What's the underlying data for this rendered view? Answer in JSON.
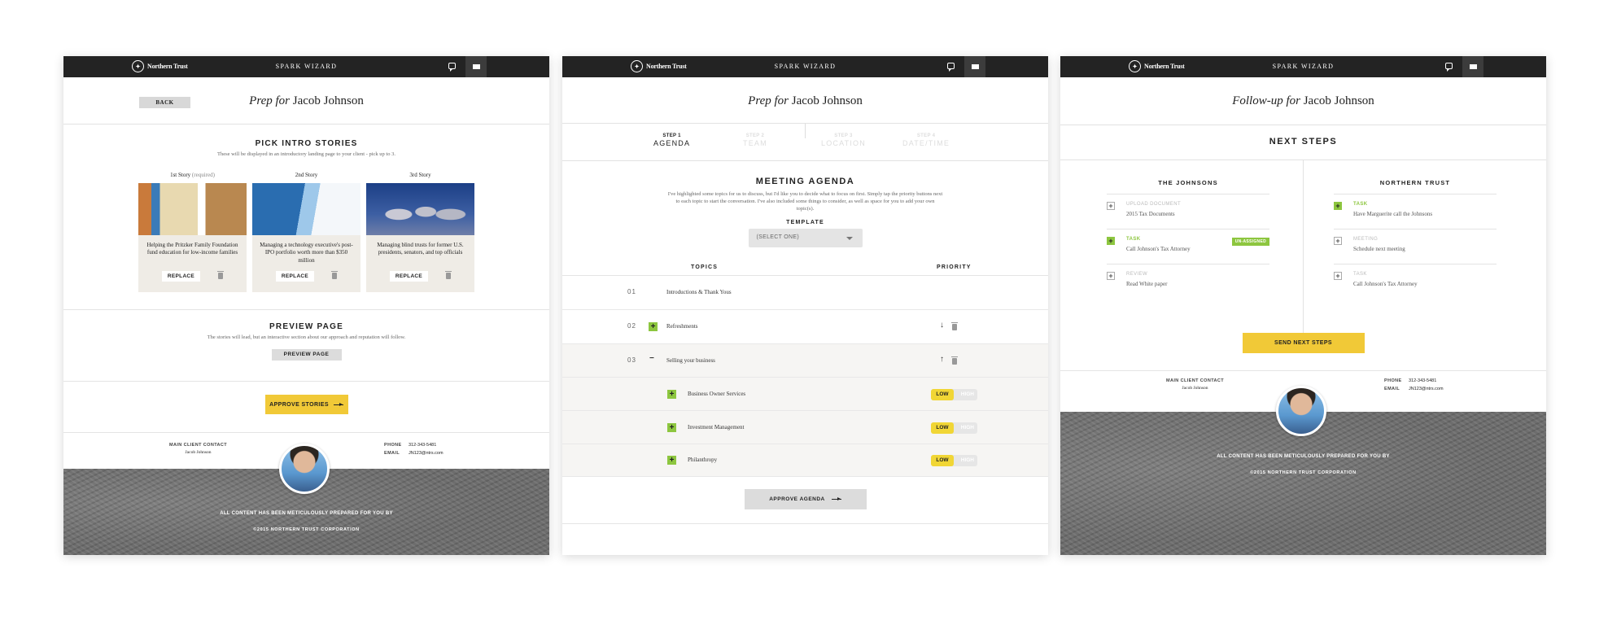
{
  "common": {
    "brand": "Northern Trust",
    "app_title": "Spark Wizard",
    "client_first": "Jacob Johnson",
    "contact": {
      "main_label": "MAIN CLIENT CONTACT",
      "main_name": "Jacob Johnson",
      "phone_label": "PHONE",
      "phone": "312-343-5481",
      "email_label": "EMAIL",
      "email": "JN123@ntrs.com"
    },
    "footer_line1": "ALL CONTENT HAS BEEN METICULOUSLY PREPARED FOR YOU BY",
    "footer_line2": "©2015 NORTHERN TRUST CORPORATION"
  },
  "panel1": {
    "back_label": "BACK",
    "title_italic": "Prep for",
    "title_name": "Jacob Johnson",
    "pick_heading": "PICK INTRO STORIES",
    "pick_sub": "These will be displayed in an introductory landing page to your client - pick up to 3.",
    "stories": [
      {
        "label": "1st Story",
        "note": "(required)",
        "text": "Helping the Pritzker Family Foundation fund education for low-income families",
        "replace": "REPLACE"
      },
      {
        "label": "2nd Story",
        "note": "",
        "text": "Managing a technology executive's post-IPO portfolio worth more than $350 million",
        "replace": "REPLACE"
      },
      {
        "label": "3rd Story",
        "note": "",
        "text": "Managing blind trusts for former U.S. presidents, senators, and top officials",
        "replace": "REPLACE"
      }
    ],
    "preview_heading": "PREVIEW PAGE",
    "preview_sub": "The stories will lead, but an interactive section about our approach and reputation will follow.",
    "preview_button": "PREVIEW PAGE",
    "approve_button": "APPROVE STORIES"
  },
  "panel2": {
    "title_italic": "Prep for",
    "title_name": "Jacob Johnson",
    "steps": [
      {
        "num": "STEP 1",
        "name": "AGENDA"
      },
      {
        "num": "STEP 2",
        "name": "TEAM"
      },
      {
        "num": "STEP 3",
        "name": "LOCATION"
      },
      {
        "num": "STEP 4",
        "name": "DATE/TIME"
      }
    ],
    "agenda_heading": "MEETING AGENDA",
    "agenda_sub": "I've highlighted some topics for us to discuss, but I'd like you to decide what to focus on first. Simply tap the priority buttons next to each topic to start the conversation. I've also included some things to consider, as well as space for you to add your own topic(s).",
    "template_label": "TEMPLATE",
    "template_value": "(SELECT ONE)",
    "col_topics": "TOPICS",
    "col_priority": "PRIORITY",
    "rows": [
      {
        "num": "01",
        "text": "Introductions & Thank Yous"
      },
      {
        "num": "02",
        "text": "Refreshments"
      },
      {
        "num": "03",
        "text": "Selling your business"
      }
    ],
    "subrows": [
      {
        "text": "Business Owner Services",
        "low": "LOW",
        "high": "HIGH"
      },
      {
        "text": "Investment Management",
        "low": "LOW",
        "high": "HIGH"
      },
      {
        "text": "Philanthropy",
        "low": "LOW",
        "high": "HIGH"
      }
    ],
    "approve_button": "APPROVE AGENDA"
  },
  "panel3": {
    "title_italic": "Follow-up for",
    "title_name": "Jacob Johnson",
    "next_heading": "NEXT STEPS",
    "col_left": "THE JOHNSONS",
    "col_right": "NORTHERN TRUST",
    "left_items": [
      {
        "kind": "UPLOAD DOCUMENT",
        "value": "2015 Tax Documents",
        "active": false,
        "badge": ""
      },
      {
        "kind": "TASK",
        "value": "Call Johnson's Tax Attorney",
        "active": true,
        "badge": "UN-ASSIGNED"
      },
      {
        "kind": "REVIEW",
        "value": "Read White paper",
        "active": false,
        "badge": ""
      }
    ],
    "right_items": [
      {
        "kind": "TASK",
        "value": "Have Marguerite call the Johnsons",
        "active": true
      },
      {
        "kind": "MEETING",
        "value": "Schedule next meeting",
        "active": false
      },
      {
        "kind": "TASK",
        "value": "Call Johnson's Tax Attorney",
        "active": false
      }
    ],
    "send_button": "SEND NEXT STEPS"
  },
  "colors": {
    "accent_yellow": "#f1c937",
    "accent_green": "#8dc63f",
    "topbar": "#232323"
  }
}
